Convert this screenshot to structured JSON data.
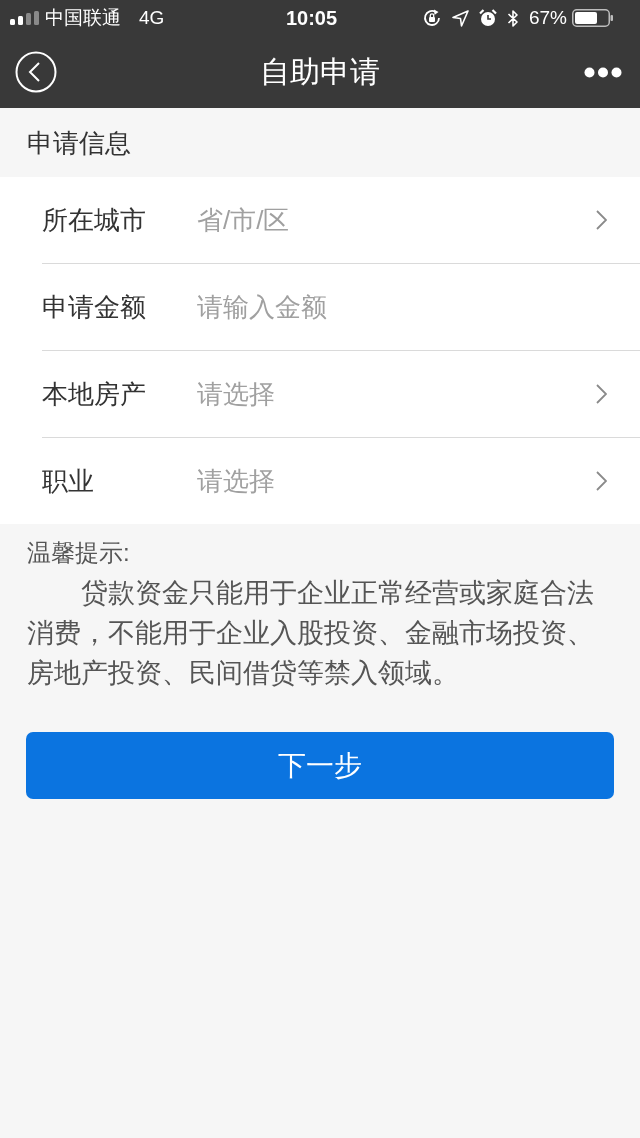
{
  "status_bar": {
    "carrier": "中国联通",
    "network": "4G",
    "time": "10:05",
    "battery_percent": "67%"
  },
  "nav": {
    "title": "自助申请"
  },
  "section": {
    "title": "申请信息"
  },
  "form": {
    "fields": [
      {
        "kind": "select",
        "label": "所在城市",
        "placeholder": "省/市/区"
      },
      {
        "kind": "input",
        "label": "申请金额",
        "placeholder": "请输入金额"
      },
      {
        "kind": "select",
        "label": "本地房产",
        "placeholder": "请选择"
      },
      {
        "kind": "select",
        "label": "职业",
        "placeholder": "请选择"
      }
    ]
  },
  "tip": {
    "title": "温馨提示:",
    "text": "贷款资金只能用于企业正常经营或家庭合法消费，不能用于企业入股投资、金融市场投资、房地产投资、民间借贷等禁入领域。"
  },
  "button": {
    "label": "下一步"
  }
}
